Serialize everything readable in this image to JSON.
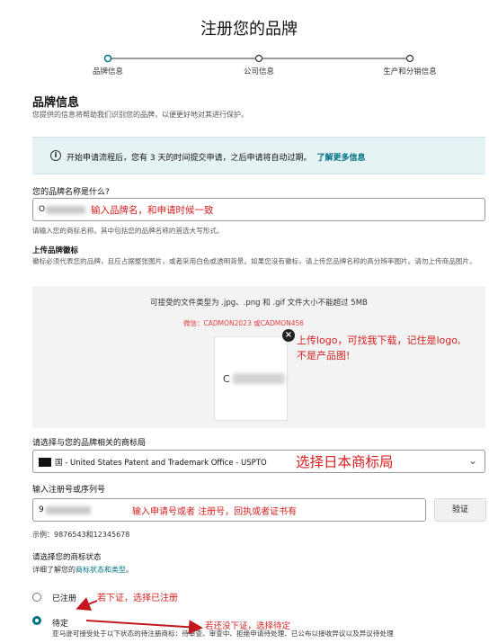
{
  "page": {
    "title": "注册您的品牌"
  },
  "steps": [
    "品牌信息",
    "公司信息",
    "生产和分销信息"
  ],
  "brand_section": {
    "heading": "品牌信息",
    "subtitle": "您提供的信息将帮助我们识别您的品牌，以便更好地对其进行保护。"
  },
  "alert": {
    "icon": "info-icon",
    "text": "开始申请流程后，您有 3 天的时间提交申请，之后申请将自动过期。",
    "link": "了解更多信息"
  },
  "brand_name": {
    "label": "您的品牌名称是什么?",
    "value_prefix": "O",
    "hint": "请输入您的商标名称。其中包括您的品牌名称的首选大写形式。",
    "annotation": "输入品牌名，和申请时候一致"
  },
  "logo_upload": {
    "label": "上传品牌徽标",
    "hint": "徽标必须代表您的品牌，且应占据整张图片，或者采用白色或透明背景。如果您没有徽标，请上传您品牌名称的高分辨率图片。请勿上传商品图片。",
    "accepted_types": "可接受的文件类型为 .jpg、.png 和 .gif   文件大小不能超过 5MB",
    "watermark": "微信：CADMON2023 或CADMON456",
    "preview_initial": "C",
    "annotation_line1": "上传logo，可找我下载，记住是logo,",
    "annotation_line2": "不是产品图!"
  },
  "trademark_office": {
    "label": "请选择与您的品牌相关的商标局",
    "selected": "国 - United States Patent and Trademark Office - USPTO",
    "annotation": "选择日本商标局"
  },
  "registration_number": {
    "label": "输入注册号或序列号",
    "value_prefix": "9",
    "annotation": "输入申请号或者 注册号，回执或者证书有",
    "verify_button": "验证",
    "example": "示例：9876543和12345678"
  },
  "trademark_status": {
    "label": "请选择您的商标状态",
    "detail_prefix": "详细了解您的",
    "detail_link": "商标状态和类型",
    "detail_suffix": "。",
    "options": [
      {
        "label": "已注册",
        "checked": false,
        "annotation": "若下证，选择已注册"
      },
      {
        "label": "待定",
        "checked": true,
        "annotation": "若还没下证，选择待定"
      }
    ],
    "pending_note": "亚马逊可接受处于以下状态的待注册商标：待审查、审查中、拒绝申请待处理、已公布以接收异议以及异议待处理"
  }
}
